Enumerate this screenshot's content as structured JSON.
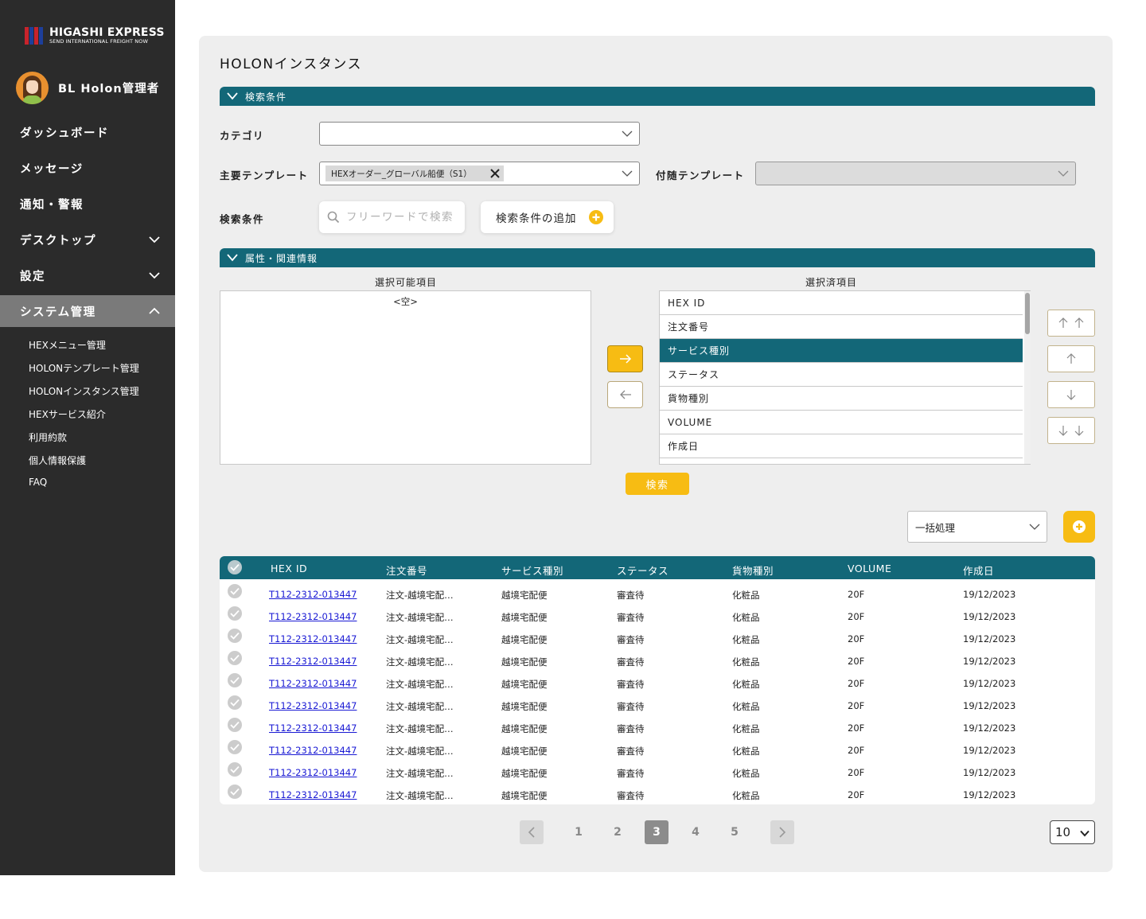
{
  "brand": {
    "name": "HIGASHI EXPRESS",
    "tagline": "SEND INTERNATIONAL FREIGHT NOW"
  },
  "user": {
    "name": "BL Holon管理者"
  },
  "sidebar": {
    "items": [
      {
        "label": "ダッシュボード"
      },
      {
        "label": "メッセージ"
      },
      {
        "label": "通知・警報"
      },
      {
        "label": "デスクトップ"
      },
      {
        "label": "設定"
      },
      {
        "label": "システム管理"
      }
    ],
    "subitems": [
      {
        "label": "HEXメニュー管理"
      },
      {
        "label": "HOLONテンプレート管理"
      },
      {
        "label": "HOLONインスタンス管理"
      },
      {
        "label": "HEXサービス紹介"
      },
      {
        "label": "利用約款"
      },
      {
        "label": "個人情報保護"
      },
      {
        "label": "FAQ"
      }
    ]
  },
  "page": {
    "title": "HOLONインスタンス"
  },
  "search_section": {
    "title": "検索条件",
    "category_label": "カテゴリ",
    "category_value": "",
    "main_template_label": "主要テンプレート",
    "main_template_chip": "HEXオーダー_グローバル船便（S1）",
    "sub_template_label": "付随テンプレート",
    "conditions_label": "検索条件",
    "search_placeholder": "フリーワードで検索",
    "add_condition_label": "検索条件の追加"
  },
  "attr_section": {
    "title": "属性・関連情報",
    "available_title": "選択可能項目",
    "available_empty": "<空>",
    "selected_title": "選択済項目",
    "selected_items": [
      {
        "label": "HEX ID",
        "selected": false
      },
      {
        "label": "注文番号",
        "selected": false
      },
      {
        "label": "サービス種別",
        "selected": true
      },
      {
        "label": "ステータス",
        "selected": false
      },
      {
        "label": "貨物種別",
        "selected": false
      },
      {
        "label": "VOLUME",
        "selected": false
      },
      {
        "label": "作成日",
        "selected": false
      }
    ],
    "search_button": "検索"
  },
  "bulk": {
    "label": "一括処理"
  },
  "table": {
    "headers": [
      "HEX ID",
      "注文番号",
      "サービス種別",
      "ステータス",
      "貨物種別",
      "VOLUME",
      "作成日"
    ],
    "rows": [
      [
        "T112-2312-013447",
        "注文-越境宅配…",
        "越境宅配便",
        "審査待",
        "化粧品",
        "20F",
        "19/12/2023"
      ],
      [
        "T112-2312-013447",
        "注文-越境宅配…",
        "越境宅配便",
        "審査待",
        "化粧品",
        "20F",
        "19/12/2023"
      ],
      [
        "T112-2312-013447",
        "注文-越境宅配…",
        "越境宅配便",
        "審査待",
        "化粧品",
        "20F",
        "19/12/2023"
      ],
      [
        "T112-2312-013447",
        "注文-越境宅配…",
        "越境宅配便",
        "審査待",
        "化粧品",
        "20F",
        "19/12/2023"
      ],
      [
        "T112-2312-013447",
        "注文-越境宅配…",
        "越境宅配便",
        "審査待",
        "化粧品",
        "20F",
        "19/12/2023"
      ],
      [
        "T112-2312-013447",
        "注文-越境宅配…",
        "越境宅配便",
        "審査待",
        "化粧品",
        "20F",
        "19/12/2023"
      ],
      [
        "T112-2312-013447",
        "注文-越境宅配…",
        "越境宅配便",
        "審査待",
        "化粧品",
        "20F",
        "19/12/2023"
      ],
      [
        "T112-2312-013447",
        "注文-越境宅配…",
        "越境宅配便",
        "審査待",
        "化粧品",
        "20F",
        "19/12/2023"
      ],
      [
        "T112-2312-013447",
        "注文-越境宅配…",
        "越境宅配便",
        "審査待",
        "化粧品",
        "20F",
        "19/12/2023"
      ],
      [
        "T112-2312-013447",
        "注文-越境宅配…",
        "越境宅配便",
        "審査待",
        "化粧品",
        "20F",
        "19/12/2023"
      ]
    ]
  },
  "pagination": {
    "pages": [
      "1",
      "2",
      "3",
      "4",
      "5"
    ],
    "current": "3",
    "per_page": "10"
  },
  "colors": {
    "teal": "#136778",
    "accent_yellow": "#f7bc13",
    "sidebar_bg": "#2b2b2b"
  }
}
